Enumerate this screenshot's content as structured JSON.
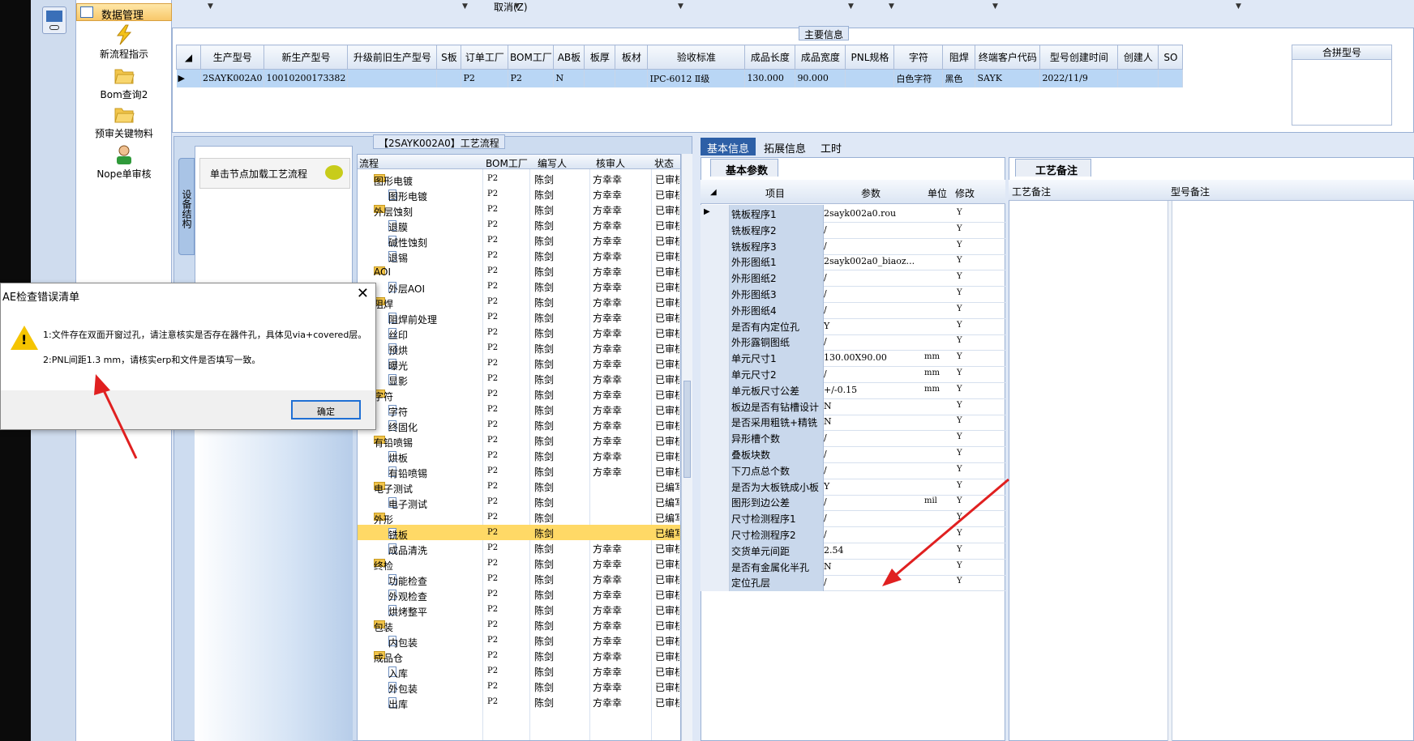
{
  "nav": {
    "header": "数据管理",
    "items": [
      {
        "label": "新流程指示",
        "icon": "lightning-icon"
      },
      {
        "label": "Bom查询2",
        "icon": "folder-open-icon"
      },
      {
        "label": "预审关键物料",
        "icon": "folder-open-icon"
      },
      {
        "label": "Nope单审核",
        "icon": "user-icon"
      }
    ]
  },
  "toolbar": {
    "cancel_label": "取消(Z)"
  },
  "main_info": {
    "title": "主要信息",
    "columns": [
      "生产型号",
      "新生产型号",
      "升级前旧生产型号",
      "S板",
      "订单工厂",
      "BOM工厂",
      "AB板",
      "板厚",
      "板材",
      "验收标准",
      "成品长度",
      "成品宽度",
      "PNL规格",
      "字符",
      "阻焊",
      "终端客户代码",
      "型号创建时间",
      "创建人",
      "SO"
    ],
    "row": [
      "2SAYK002A0",
      "10010200173382",
      "",
      "",
      "P2",
      "P2",
      "N",
      "",
      "",
      "IPC-6012 Ⅱ级",
      "130.000",
      "90.000",
      "",
      "白色字符",
      "黑色",
      "SAYK",
      "2022/11/9",
      "",
      ""
    ],
    "merge_header": "合拼型号"
  },
  "flow": {
    "title": "【2SAYK002A0】工艺流程",
    "equip_tab": "设备结构",
    "equip_hint": "单击节点加载工艺流程",
    "headers": [
      "流程",
      "BOM工厂",
      "编写人",
      "核审人",
      "状态"
    ],
    "rows": [
      {
        "name": "图形电镀",
        "level": 0,
        "factory": "P2",
        "writer": "陈剑",
        "reviewer": "方幸幸",
        "status": "已审核"
      },
      {
        "name": "图形电镀",
        "level": 1,
        "factory": "P2",
        "writer": "陈剑",
        "reviewer": "方幸幸",
        "status": "已审核"
      },
      {
        "name": "外层蚀刻",
        "level": 0,
        "factory": "P2",
        "writer": "陈剑",
        "reviewer": "方幸幸",
        "status": "已审核"
      },
      {
        "name": "退膜",
        "level": 1,
        "factory": "P2",
        "writer": "陈剑",
        "reviewer": "方幸幸",
        "status": "已审核"
      },
      {
        "name": "碱性蚀刻",
        "level": 1,
        "factory": "P2",
        "writer": "陈剑",
        "reviewer": "方幸幸",
        "status": "已审核"
      },
      {
        "name": "退锡",
        "level": 1,
        "factory": "P2",
        "writer": "陈剑",
        "reviewer": "方幸幸",
        "status": "已审核"
      },
      {
        "name": "AOI",
        "level": 0,
        "factory": "P2",
        "writer": "陈剑",
        "reviewer": "方幸幸",
        "status": "已审核"
      },
      {
        "name": "外层AOI",
        "level": 1,
        "factory": "P2",
        "writer": "陈剑",
        "reviewer": "方幸幸",
        "status": "已审核"
      },
      {
        "name": "阻焊",
        "level": 0,
        "factory": "P2",
        "writer": "陈剑",
        "reviewer": "方幸幸",
        "status": "已审核"
      },
      {
        "name": "阻焊前处理",
        "level": 1,
        "factory": "P2",
        "writer": "陈剑",
        "reviewer": "方幸幸",
        "status": "已审核"
      },
      {
        "name": "丝印",
        "level": 1,
        "factory": "P2",
        "writer": "陈剑",
        "reviewer": "方幸幸",
        "status": "已审核"
      },
      {
        "name": "预烘",
        "level": 1,
        "factory": "P2",
        "writer": "陈剑",
        "reviewer": "方幸幸",
        "status": "已审核"
      },
      {
        "name": "曝光",
        "level": 1,
        "factory": "P2",
        "writer": "陈剑",
        "reviewer": "方幸幸",
        "status": "已审核"
      },
      {
        "name": "显影",
        "level": 1,
        "factory": "P2",
        "writer": "陈剑",
        "reviewer": "方幸幸",
        "status": "已审核"
      },
      {
        "name": "字符",
        "level": 0,
        "factory": "P2",
        "writer": "陈剑",
        "reviewer": "方幸幸",
        "status": "已审核"
      },
      {
        "name": "字符",
        "level": 1,
        "factory": "P2",
        "writer": "陈剑",
        "reviewer": "方幸幸",
        "status": "已审核"
      },
      {
        "name": "终固化",
        "level": 1,
        "factory": "P2",
        "writer": "陈剑",
        "reviewer": "方幸幸",
        "status": "已审核"
      },
      {
        "name": "有铅喷锡",
        "level": 0,
        "factory": "P2",
        "writer": "陈剑",
        "reviewer": "方幸幸",
        "status": "已审核"
      },
      {
        "name": "烘板",
        "level": 1,
        "factory": "P2",
        "writer": "陈剑",
        "reviewer": "方幸幸",
        "status": "已审核"
      },
      {
        "name": "有铅喷锡",
        "level": 1,
        "factory": "P2",
        "writer": "陈剑",
        "reviewer": "方幸幸",
        "status": "已审核"
      },
      {
        "name": "电子测试",
        "level": 0,
        "factory": "P2",
        "writer": "陈剑",
        "reviewer": "",
        "status": "已编写"
      },
      {
        "name": "电子测试",
        "level": 1,
        "factory": "P2",
        "writer": "陈剑",
        "reviewer": "",
        "status": "已编写"
      },
      {
        "name": "外形",
        "level": 0,
        "factory": "P2",
        "writer": "陈剑",
        "reviewer": "",
        "status": "已编写"
      },
      {
        "name": "铣板",
        "level": 1,
        "factory": "P2",
        "writer": "陈剑",
        "reviewer": "",
        "status": "已编写",
        "selected": true
      },
      {
        "name": "成品清洗",
        "level": 1,
        "factory": "P2",
        "writer": "陈剑",
        "reviewer": "方幸幸",
        "status": "已审核"
      },
      {
        "name": "终检",
        "level": 0,
        "factory": "P2",
        "writer": "陈剑",
        "reviewer": "方幸幸",
        "status": "已审核"
      },
      {
        "name": "功能检查",
        "level": 1,
        "factory": "P2",
        "writer": "陈剑",
        "reviewer": "方幸幸",
        "status": "已审核"
      },
      {
        "name": "外观检查",
        "level": 1,
        "factory": "P2",
        "writer": "陈剑",
        "reviewer": "方幸幸",
        "status": "已审核"
      },
      {
        "name": "烘烤整平",
        "level": 1,
        "factory": "P2",
        "writer": "陈剑",
        "reviewer": "方幸幸",
        "status": "已审核"
      },
      {
        "name": "包装",
        "level": 0,
        "factory": "P2",
        "writer": "陈剑",
        "reviewer": "方幸幸",
        "status": "已审核"
      },
      {
        "name": "内包装",
        "level": 1,
        "factory": "P2",
        "writer": "陈剑",
        "reviewer": "方幸幸",
        "status": "已审核"
      },
      {
        "name": "成品仓",
        "level": 0,
        "factory": "P2",
        "writer": "陈剑",
        "reviewer": "方幸幸",
        "status": "已审核"
      },
      {
        "name": "入库",
        "level": 1,
        "factory": "P2",
        "writer": "陈剑",
        "reviewer": "方幸幸",
        "status": "已审核"
      },
      {
        "name": "外包装",
        "level": 1,
        "factory": "P2",
        "writer": "陈剑",
        "reviewer": "方幸幸",
        "status": "已审核"
      },
      {
        "name": "出库",
        "level": 1,
        "factory": "P2",
        "writer": "陈剑",
        "reviewer": "方幸幸",
        "status": "已审核"
      }
    ]
  },
  "right_tabs": [
    "基本信息",
    "拓展信息",
    "工时"
  ],
  "basic_params": {
    "tab": "基本参数",
    "headers": [
      "项目",
      "参数",
      "单位",
      "修改"
    ],
    "rows": [
      [
        "铣板程序1",
        "2sayk002a0.rou",
        "",
        "Y"
      ],
      [
        "铣板程序2",
        "/",
        "",
        "Y"
      ],
      [
        "铣板程序3",
        "/",
        "",
        "Y"
      ],
      [
        "外形图纸1",
        "2sayk002a0_biaoz...",
        "",
        "Y"
      ],
      [
        "外形图纸2",
        "/",
        "",
        "Y"
      ],
      [
        "外形图纸3",
        "/",
        "",
        "Y"
      ],
      [
        "外形图纸4",
        "/",
        "",
        "Y"
      ],
      [
        "是否有内定位孔",
        "Y",
        "",
        "Y"
      ],
      [
        "外形露铜图纸",
        "/",
        "",
        "Y"
      ],
      [
        "单元尺寸1",
        "130.00X90.00",
        "mm",
        "Y"
      ],
      [
        "单元尺寸2",
        "/",
        "mm",
        "Y"
      ],
      [
        "单元板尺寸公差",
        "+/-0.15",
        "mm",
        "Y"
      ],
      [
        "板边是否有钻槽设计",
        "N",
        "",
        "Y"
      ],
      [
        "是否采用粗铣+精铣",
        "N",
        "",
        "Y"
      ],
      [
        "异形槽个数",
        "/",
        "",
        "Y"
      ],
      [
        "叠板块数",
        "/",
        "",
        "Y"
      ],
      [
        "下刀点总个数",
        "/",
        "",
        "Y"
      ],
      [
        "是否为大板铣成小板",
        "Y",
        "",
        "Y"
      ],
      [
        "图形到边公差",
        "/",
        "mil",
        "Y"
      ],
      [
        "尺寸检测程序1",
        "/",
        "",
        "Y"
      ],
      [
        "尺寸检测程序2",
        "/",
        "",
        "Y"
      ],
      [
        "交货单元间距",
        "2.54",
        "",
        "Y"
      ],
      [
        "是否有金属化半孔",
        "N",
        "",
        "Y"
      ],
      [
        "定位孔层",
        "/",
        "",
        "Y"
      ]
    ]
  },
  "remarks": {
    "tab": "工艺备注",
    "col1": "工艺备注",
    "col2": "型号备注"
  },
  "dialog": {
    "title": "AE检查错误清单",
    "line1": "1:文件存在双面开窗过孔，请注意核实是否存在器件孔，具体见via+covered层。",
    "line2": "2:PNL间距1.3 mm，请核实erp和文件是否填写一致。",
    "ok": "确定"
  },
  "colors": {
    "accent": "#2d5fa6",
    "selected_row": "#b9d6f5",
    "highlight_row": "#ffd966",
    "arrow": "#e02020"
  }
}
